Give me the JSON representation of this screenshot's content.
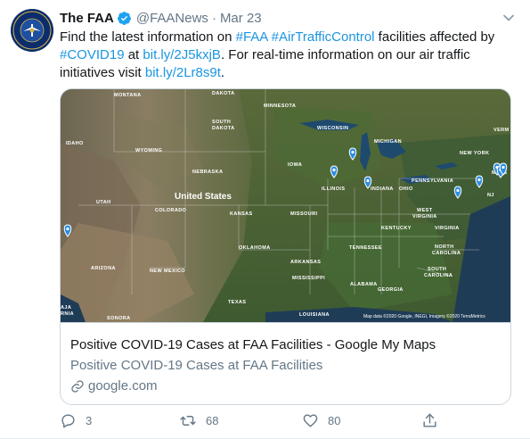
{
  "author": {
    "name": "The FAA",
    "handle": "@FAANews",
    "separator": "·",
    "date": "Mar 23",
    "avatar_ring_text": "FEDERAL AVIATION ADMINISTRATION"
  },
  "tweet": {
    "segments": [
      {
        "text": "Find the latest information on ",
        "type": "text"
      },
      {
        "text": "#FAA",
        "type": "link"
      },
      {
        "text": " ",
        "type": "text"
      },
      {
        "text": "#AirTrafficControl",
        "type": "link"
      },
      {
        "text": " facilities affected by ",
        "type": "text"
      },
      {
        "text": "#COVID19",
        "type": "link"
      },
      {
        "text": " at ",
        "type": "text"
      },
      {
        "text": "bit.ly/2J5kxjB",
        "type": "link"
      },
      {
        "text": ". For real-time information on our air traffic initiatives visit ",
        "type": "text"
      },
      {
        "text": "bit.ly/2Lr8s9t",
        "type": "link"
      },
      {
        "text": ".",
        "type": "text"
      }
    ]
  },
  "map": {
    "country_label": "United States",
    "attribution": "Map data ©2020 Google, INEGI, Imagery ©2020 TerraMetrics",
    "state_labels": [
      "MONTANA",
      "DAKOTA",
      "MINNESOTA",
      "SOUTH DAKOTA",
      "WISCONSIN",
      "IDAHO",
      "WYOMING",
      "MICHIGAN",
      "VERM",
      "NEBRASKA",
      "IOWA",
      "NEW YORK",
      "ILLINOIS",
      "INDIANA",
      "OHIO",
      "PENNSYLVANIA",
      "MASS",
      "UTAH",
      "COLORADO",
      "KANSAS",
      "MISSOURI",
      "WEST VIRGINIA",
      "NJ",
      "KENTUCKY",
      "VIRGINIA",
      "OKLAHOMA",
      "TENNESSEE",
      "NORTH CAROLINA",
      "ARIZONA",
      "NEW MEXICO",
      "ARKANSAS",
      "SOUTH CAROLINA",
      "MISSISSIPPI",
      "ALABAMA",
      "GEORGIA",
      "TEXAS",
      "LOUISIANA",
      "SONORA",
      "AJA",
      "RNIA"
    ]
  },
  "card": {
    "title": "Positive COVID-19 Cases at FAA Facilities - Google My Maps",
    "description": "Positive COVID-19 Cases at FAA Facilities",
    "domain": "google.com"
  },
  "actions": {
    "replies": "3",
    "retweets": "68",
    "likes": "80"
  },
  "colors": {
    "link": "#1b95e0",
    "verified": "#1da1f2",
    "marker": "#2b8de3",
    "muted": "#657786"
  }
}
